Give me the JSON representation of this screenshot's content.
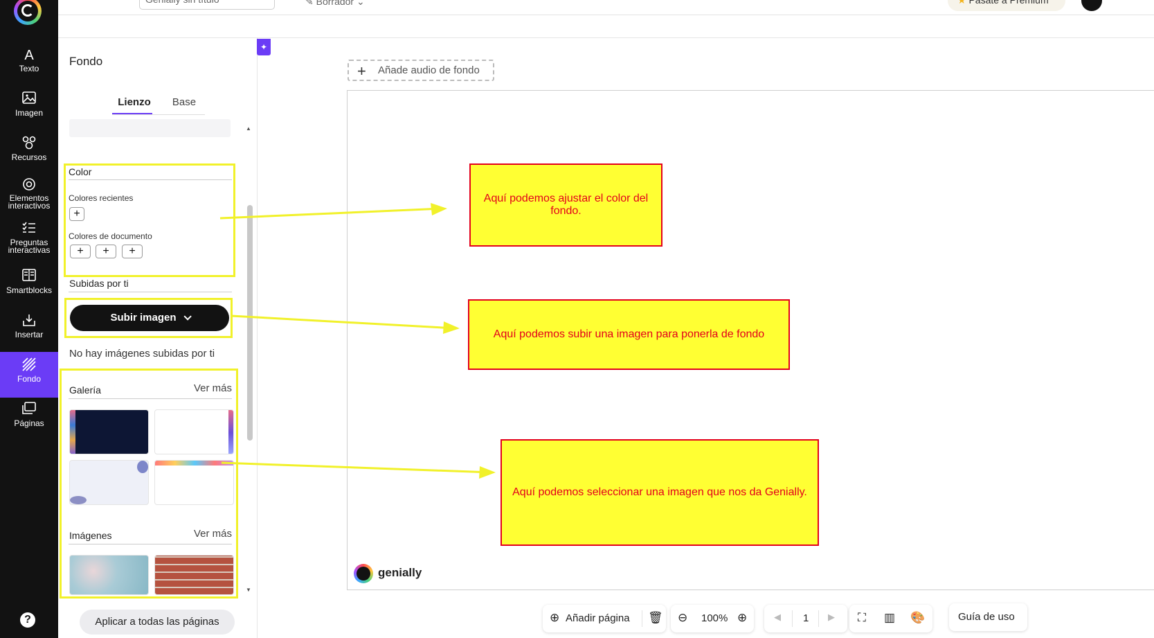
{
  "rail": {
    "items": [
      {
        "label": "Texto",
        "icon": "text-icon"
      },
      {
        "label": "Imagen",
        "icon": "image-icon"
      },
      {
        "label": "Recursos",
        "icon": "resources-icon"
      },
      {
        "label": "Elementos\ninteractivos",
        "icon": "interactive-elements-icon"
      },
      {
        "label": "Preguntas\ninteractivas",
        "icon": "questions-icon"
      },
      {
        "label": "Smartblocks",
        "icon": "smartblocks-icon"
      },
      {
        "label": "Insertar",
        "icon": "insert-icon"
      },
      {
        "label": "Fondo",
        "icon": "background-icon",
        "active": true
      },
      {
        "label": "Páginas",
        "icon": "pages-icon"
      }
    ]
  },
  "topbar": {
    "title_value": "Genially sin título",
    "draft_label": "Borrador",
    "premium_label": "Pásate a Premium"
  },
  "panel": {
    "title": "Fondo",
    "tabs": [
      "Lienzo",
      "Base"
    ],
    "color": {
      "title": "Color",
      "recent_label": "Colores recientes",
      "document_label": "Colores de documento"
    },
    "uploads": {
      "title": "Subidas por ti",
      "button_label": "Subir imagen",
      "empty_text": "No hay imágenes subidas por ti"
    },
    "gallery": {
      "title": "Galería",
      "see_more": "Ver más"
    },
    "images": {
      "title": "Imágenes",
      "see_more": "Ver más"
    },
    "apply_label": "Aplicar a todas las páginas"
  },
  "canvas": {
    "audio_label": "Añade audio de fondo",
    "brand": "genially"
  },
  "callouts": [
    "Aquí podemos ajustar el color del fondo.",
    "Aquí podemos subir una imagen para ponerla de fondo",
    "Aquí podemos seleccionar una imagen que nos da Genially."
  ],
  "toolbar": {
    "add_page_label": "Añadir página",
    "zoom": "100%",
    "page_number": "1",
    "guide_label": "Guía de uso"
  },
  "colors": {
    "rail_bg": "#121212",
    "accent": "#6b3cf6",
    "callout_fill": "#ffff33",
    "callout_border": "#e3001b",
    "highlight": "#f1f12a"
  }
}
